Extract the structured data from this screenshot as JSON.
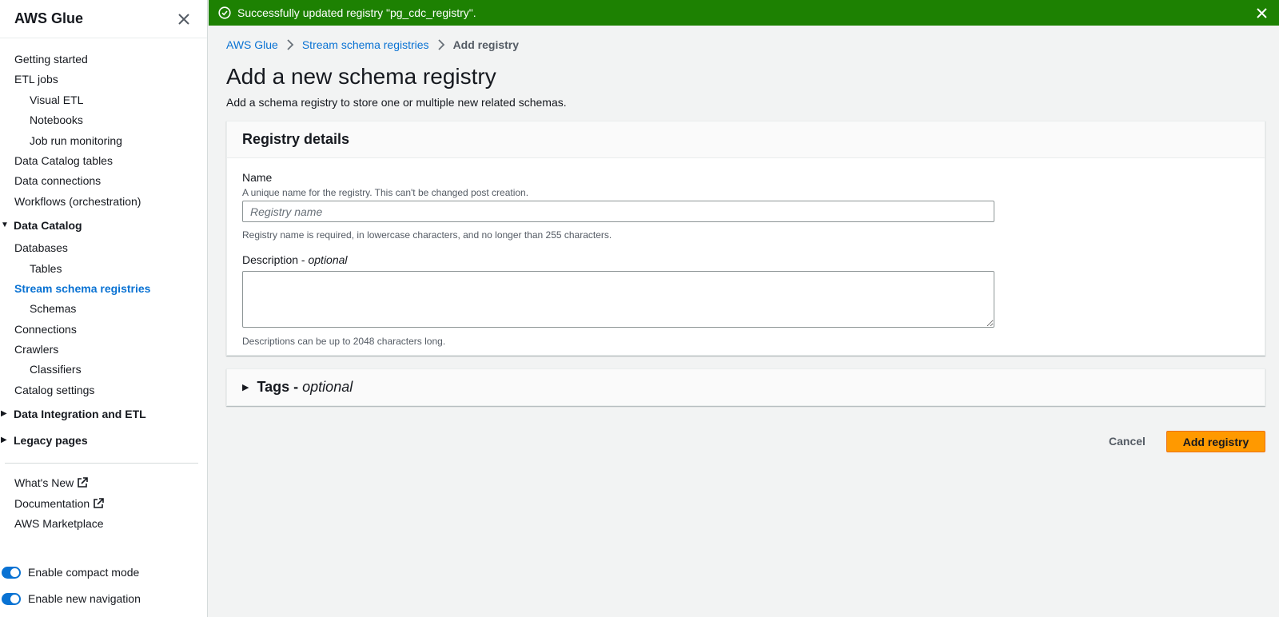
{
  "sidebar": {
    "title": "AWS Glue",
    "top_items": [
      {
        "label": "Getting started",
        "level": 1
      },
      {
        "label": "ETL jobs",
        "level": 1
      },
      {
        "label": "Visual ETL",
        "level": 2
      },
      {
        "label": "Notebooks",
        "level": 2
      },
      {
        "label": "Job run monitoring",
        "level": 2
      },
      {
        "label": "Data Catalog tables",
        "level": 1
      },
      {
        "label": "Data connections",
        "level": 1
      },
      {
        "label": "Workflows (orchestration)",
        "level": 1
      }
    ],
    "data_catalog": {
      "label": "Data Catalog",
      "items": [
        {
          "label": "Databases",
          "level": 1
        },
        {
          "label": "Tables",
          "level": 2
        },
        {
          "label": "Stream schema registries",
          "level": 1,
          "active": true
        },
        {
          "label": "Schemas",
          "level": 2
        },
        {
          "label": "Connections",
          "level": 1
        },
        {
          "label": "Crawlers",
          "level": 1
        },
        {
          "label": "Classifiers",
          "level": 2
        },
        {
          "label": "Catalog settings",
          "level": 1
        }
      ]
    },
    "data_integration": {
      "label": "Data Integration and ETL"
    },
    "legacy_pages": {
      "label": "Legacy pages"
    },
    "footer_links": [
      {
        "label": "What's New",
        "external": true
      },
      {
        "label": "Documentation",
        "external": true
      },
      {
        "label": "AWS Marketplace",
        "external": false
      }
    ],
    "toggles": [
      {
        "label": "Enable compact mode",
        "on": true
      },
      {
        "label": "Enable new navigation",
        "on": true
      }
    ]
  },
  "flash": {
    "message": "Successfully updated registry \"pg_cdc_registry\".",
    "color": "#1d8102"
  },
  "breadcrumb": {
    "items": [
      "AWS Glue",
      "Stream schema registries"
    ],
    "current": "Add registry"
  },
  "page": {
    "title": "Add a new schema registry",
    "subtitle": "Add a schema registry to store one or multiple new related schemas."
  },
  "details": {
    "heading": "Registry details",
    "name_label": "Name",
    "name_desc": "A unique name for the registry. This can't be changed post creation.",
    "name_placeholder": "Registry name",
    "name_value": "",
    "name_constraint": "Registry name is required, in lowercase characters, and no longer than 255 characters.",
    "desc_label": "Description",
    "desc_optional": "optional",
    "desc_value": "",
    "desc_constraint": "Descriptions can be up to 2048 characters long."
  },
  "tags": {
    "label": "Tags",
    "optional": "optional"
  },
  "actions": {
    "cancel": "Cancel",
    "submit": "Add registry"
  },
  "colors": {
    "accent": "#0972d3",
    "primary_button": "#ff9900",
    "success": "#1d8102"
  }
}
